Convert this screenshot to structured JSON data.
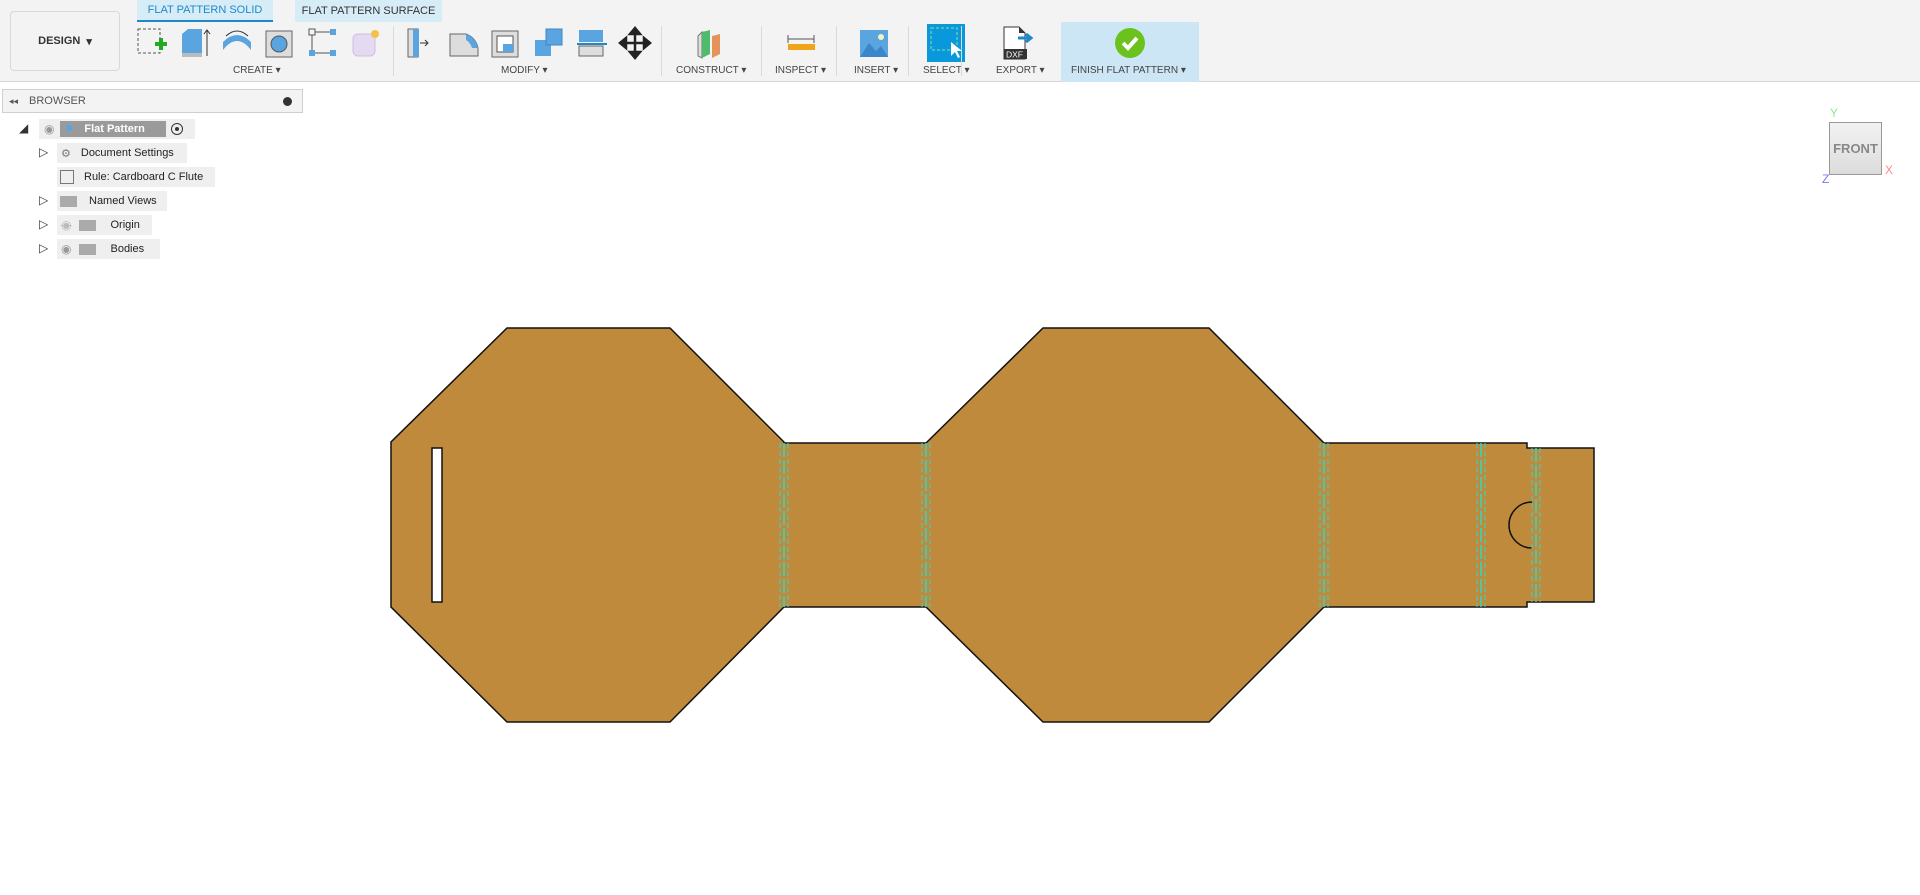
{
  "workspace": {
    "label": "DESIGN"
  },
  "tabs": [
    {
      "label": "FLAT PATTERN SOLID",
      "active": true
    },
    {
      "label": "FLAT PATTERN SURFACE",
      "active": false
    }
  ],
  "groups": {
    "create": "CREATE",
    "modify": "MODIFY",
    "construct": "CONSTRUCT",
    "inspect": "INSPECT",
    "insert": "INSERT",
    "select": "SELECT",
    "export": "EXPORT",
    "finish": "FINISH FLAT PATTERN"
  },
  "export_icon_text": "DXF",
  "browser": {
    "title": "BROWSER",
    "root": "Flat Pattern",
    "items": [
      {
        "label": "Document Settings",
        "icon": "gear-icon"
      },
      {
        "label": "Rule: Cardboard C Flute",
        "icon": "rule-icon"
      },
      {
        "label": "Named Views",
        "icon": "folder-icon"
      },
      {
        "label": "Origin",
        "icon": "folder-icon",
        "visible": false
      },
      {
        "label": "Bodies",
        "icon": "folder-icon",
        "visible": true
      }
    ]
  },
  "viewcube": {
    "face": "FRONT",
    "x": "X",
    "y": "Y",
    "z": "Z"
  },
  "colors": {
    "body": "#BF8A3B",
    "fold_line": "#33D6C8",
    "accent": "#1E88C8",
    "finish_bg": "#CDE6F5"
  }
}
